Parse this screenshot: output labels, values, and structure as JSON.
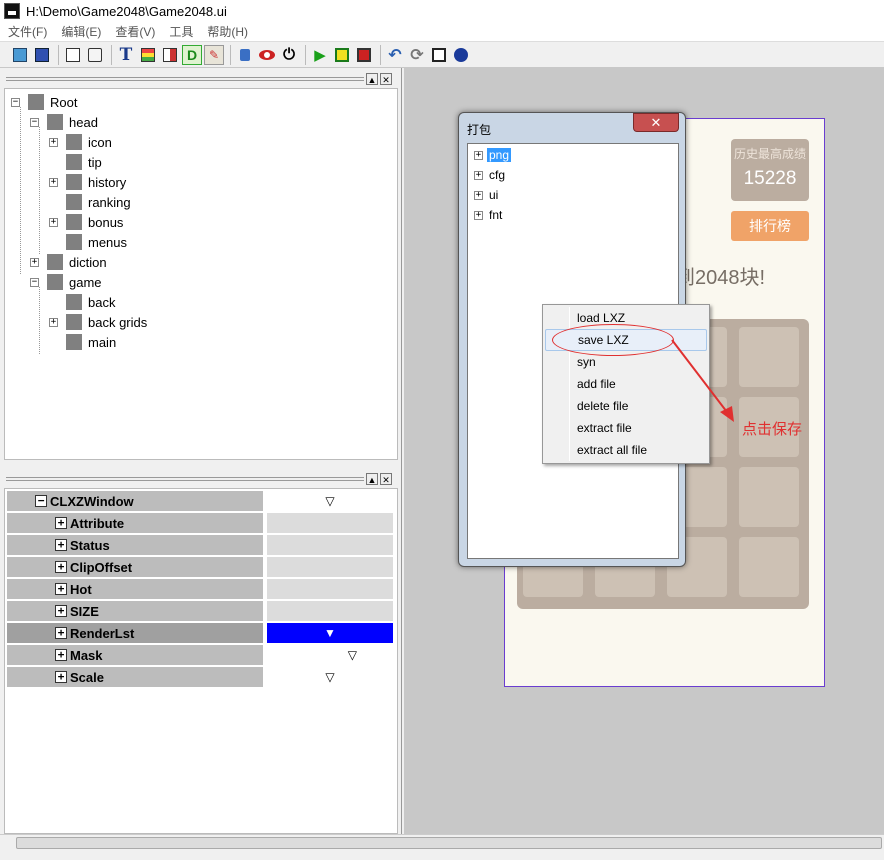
{
  "window": {
    "title": "H:\\Demo\\Game2048\\Game2048.ui"
  },
  "menu": [
    "文件(F)",
    "编辑(E)",
    "查看(V)",
    "工具",
    "帮助(H)"
  ],
  "toolbar": {
    "icons": [
      "open-icon",
      "save-icon",
      "edit-icon",
      "preview-icon",
      "text-icon",
      "grid-icon",
      "layout-icon",
      "debug-icon",
      "brush-icon",
      "lock-icon",
      "eye-icon",
      "power-icon",
      "play-icon",
      "yellow-square-icon",
      "stop-icon",
      "undo-icon",
      "refresh-icon",
      "crop-icon",
      "palette-icon"
    ],
    "d_label": "D",
    "t_label": "T"
  },
  "tree": {
    "root": "Root",
    "head": "head",
    "head_children": [
      "icon",
      "tip",
      "history",
      "ranking",
      "bonus",
      "menus"
    ],
    "diction": "diction",
    "game": "game",
    "game_children": [
      "back",
      "back grids",
      "main"
    ]
  },
  "properties": {
    "root": {
      "name": "CLXZWindow",
      "value": "▽"
    },
    "rows": [
      {
        "name": "Attribute",
        "value": ""
      },
      {
        "name": "Status",
        "value": ""
      },
      {
        "name": "ClipOffset",
        "value": ""
      },
      {
        "name": "Hot",
        "value": ""
      },
      {
        "name": "SIZE",
        "value": ""
      },
      {
        "name": "RenderLst",
        "value": "▼"
      },
      {
        "name": "Mask",
        "value": "▽"
      },
      {
        "name": "Scale",
        "value": "▽"
      }
    ]
  },
  "game": {
    "best_label": "历史最高成绩",
    "best_value": "15228",
    "score_partial": "2",
    "score_label_partial": "成",
    "ranking_button": "排行榜",
    "goal_partial": "到2048块!"
  },
  "dialog": {
    "title": "打包",
    "close": "✕",
    "items": [
      "png",
      "cfg",
      "ui",
      "fnt"
    ]
  },
  "context_menu": {
    "items": [
      "load LXZ",
      "save LXZ",
      "syn",
      "add file",
      "delete file",
      "extract file",
      "extract all file"
    ]
  },
  "annotation": "点击保存",
  "colors": {
    "annotation": "#e03030",
    "selection": "#0000ff",
    "frame": "#6a3dd0"
  }
}
